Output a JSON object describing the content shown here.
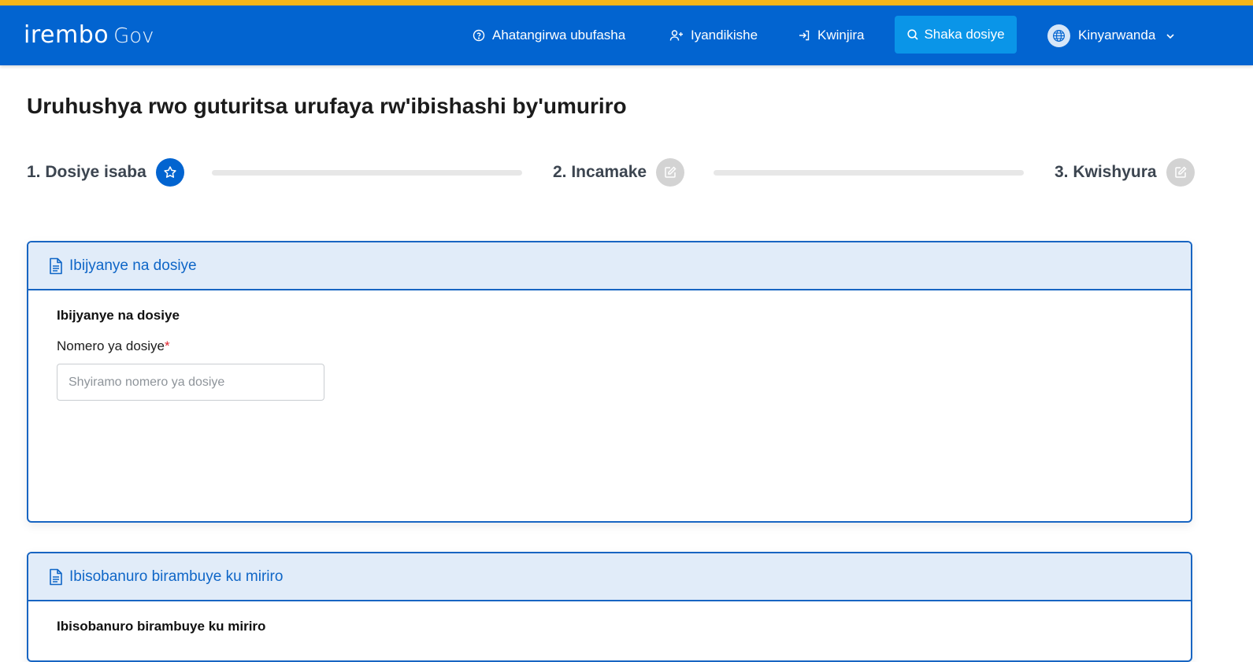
{
  "header": {
    "logo_main": "irembo",
    "logo_sub": "Gov",
    "nav": {
      "help": "Ahatangirwa ubufasha",
      "register": "Iyandikishe",
      "login": "Kwinjira",
      "search": "Shaka dosiye",
      "language": "Kinyarwanda"
    }
  },
  "page_title": "Uruhushya rwo guturitsa urufaya rw'ibishashi by'umuriro",
  "steps": [
    {
      "label": "1. Dosiye isaba",
      "icon": "star-icon",
      "state": "active"
    },
    {
      "label": "2. Incamake",
      "icon": "edit-icon",
      "state": "inactive"
    },
    {
      "label": "3. Kwishyura",
      "icon": "edit-icon",
      "state": "inactive"
    }
  ],
  "sections": [
    {
      "header": "Ibijyanye na dosiye",
      "title": "Ibijyanye na dosiye",
      "field_label": "Nomero ya dosiye",
      "required_marker": "*",
      "placeholder": "Shyiramo nomero ya dosiye"
    },
    {
      "header": "Ibisobanuro birambuye ku miriro",
      "title": "Ibisobanuro birambuye ku miriro"
    }
  ],
  "colors": {
    "brand_blue": "#0264d0",
    "accent_yellow": "#f5b51a",
    "search_button": "#0a95e8",
    "card_header_bg": "#e1ecf9",
    "required": "#e0252e"
  }
}
